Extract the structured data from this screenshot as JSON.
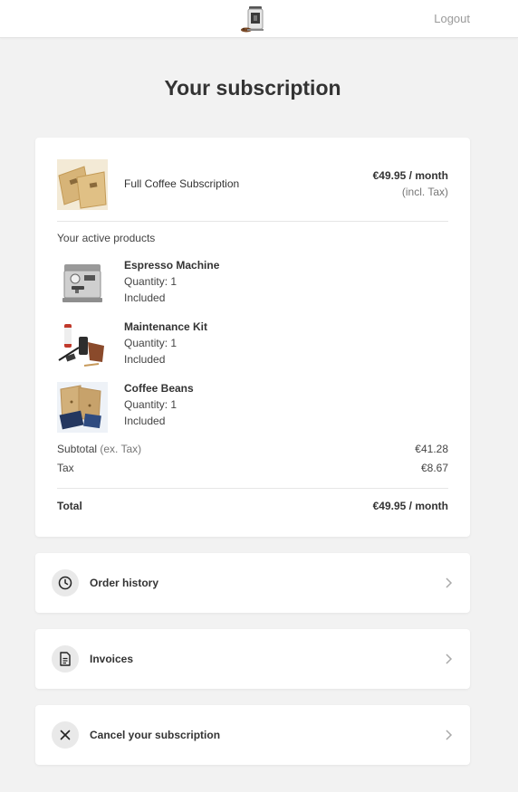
{
  "header": {
    "logo_icon": "coffee-machine-logo-icon",
    "logout_label": "Logout"
  },
  "page": {
    "title": "Your subscription"
  },
  "subscription": {
    "plan_name": "Full Coffee Subscription",
    "plan_price": "€49.95 / month",
    "plan_tax_note": "(incl. Tax)",
    "active_products_label": "Your active products",
    "products": [
      {
        "name": "Espresso Machine",
        "quantity": "Quantity: 1",
        "status": "Included",
        "icon": "espresso-machine-image"
      },
      {
        "name": "Maintenance Kit",
        "quantity": "Quantity: 1",
        "status": "Included",
        "icon": "maintenance-kit-image"
      },
      {
        "name": "Coffee Beans",
        "quantity": "Quantity: 1",
        "status": "Included",
        "icon": "coffee-beans-image"
      }
    ],
    "subtotal_label": "Subtotal",
    "subtotal_qualifier": "(ex. Tax)",
    "subtotal_value": "€41.28",
    "tax_label": "Tax",
    "tax_value": "€8.67",
    "total_label": "Total",
    "total_value": "€49.95 / month"
  },
  "actions": [
    {
      "label": "Order history",
      "icon": "clock-icon"
    },
    {
      "label": "Invoices",
      "icon": "document-icon"
    },
    {
      "label": "Cancel your subscription",
      "icon": "close-icon"
    }
  ],
  "colors": {
    "page_background": "#f2f2f2",
    "card_background": "#ffffff",
    "text_primary": "#333333",
    "text_muted": "#777777",
    "icon_circle": "#e9e9e9"
  }
}
